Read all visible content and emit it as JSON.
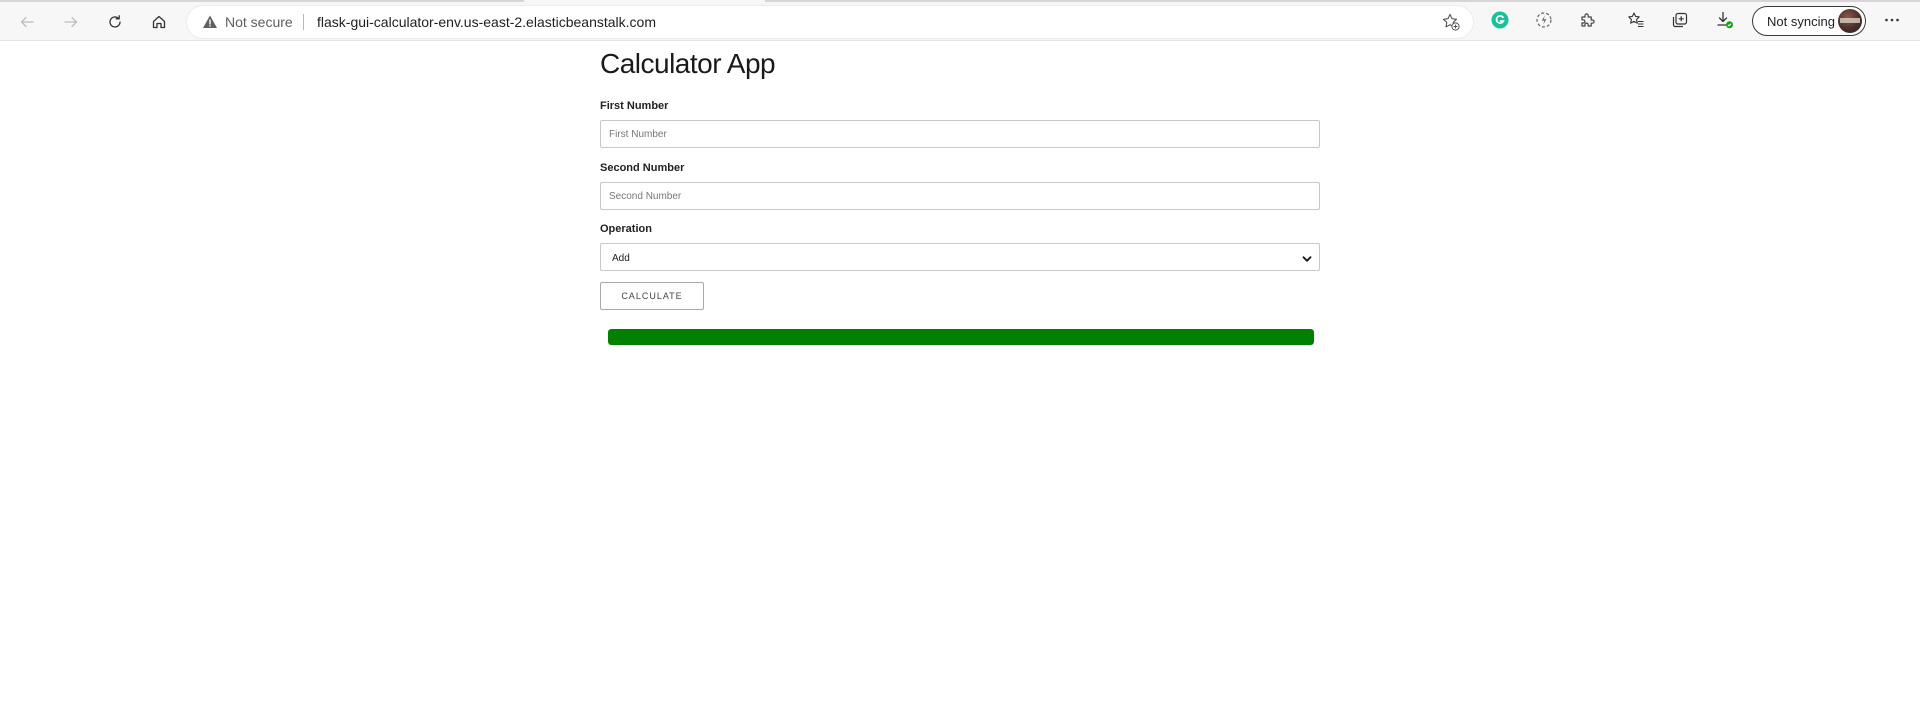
{
  "browser": {
    "address_bar": {
      "security_text": "Not secure",
      "url": "flask-gui-calculator-env.us-east-2.elasticbeanstalk.com"
    },
    "profile": {
      "label": "Not syncing"
    },
    "icons": {
      "back": "back-arrow-icon",
      "forward": "forward-arrow-icon",
      "refresh": "refresh-icon",
      "home": "home-icon",
      "warning": "warning-triangle-icon",
      "favorite": "add-favorite-icon",
      "grammarly": "grammarly-icon",
      "performance": "performance-icon",
      "extensions": "extensions-puzzle-icon",
      "favorites": "favorites-star-icon",
      "collections": "collections-icon",
      "downloads": "download-icon",
      "menu": "more-menu-icon"
    },
    "accent_colors": {
      "grammarly": "#15c39a",
      "download_badge": "#13a10e"
    }
  },
  "app": {
    "title": "Calculator App",
    "first_number": {
      "label": "First Number",
      "placeholder": "First Number",
      "value": ""
    },
    "second_number": {
      "label": "Second Number",
      "placeholder": "Second Number",
      "value": ""
    },
    "operation": {
      "label": "Operation",
      "selected": "Add"
    },
    "calculate_button": {
      "label": "CALCULATE"
    },
    "progress": {
      "percent": 100,
      "color": "#008000"
    }
  }
}
